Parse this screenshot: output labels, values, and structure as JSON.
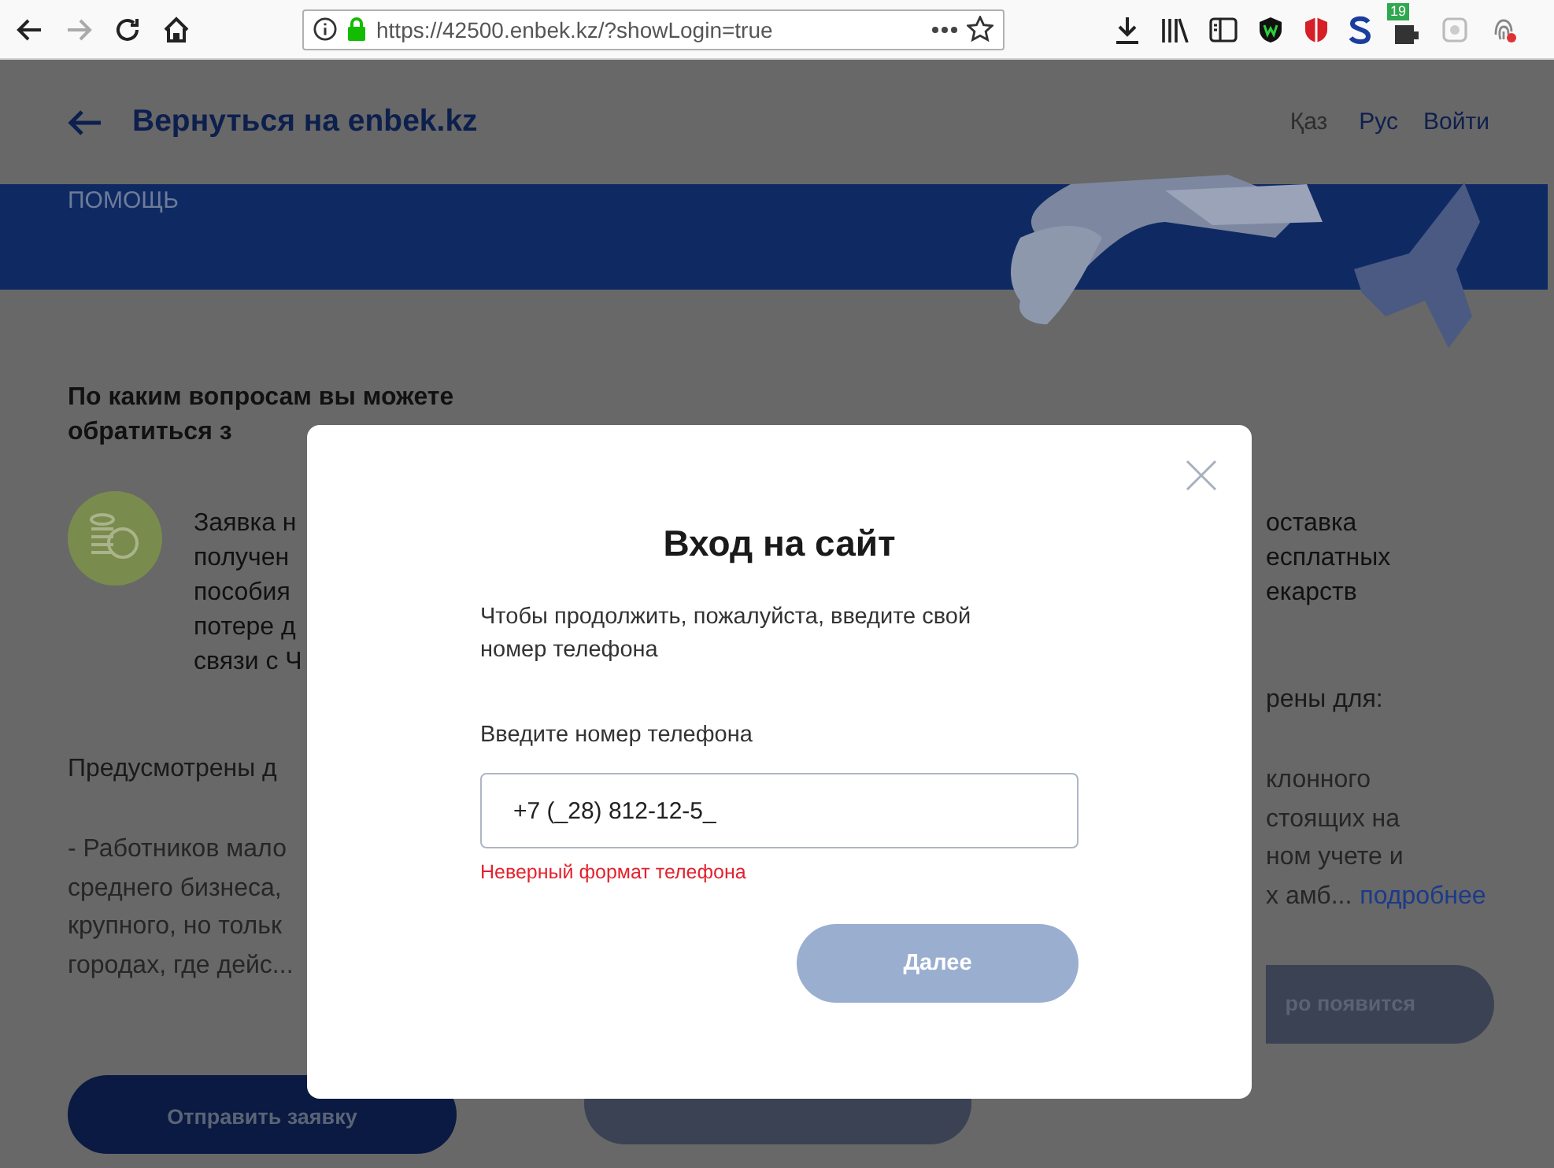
{
  "browser": {
    "url": "https://42500.enbek.kz/?showLogin=true",
    "badge": "19"
  },
  "header": {
    "back": "Вернуться на enbek.kz",
    "languages": [
      {
        "label": "Қаз",
        "selected": false
      },
      {
        "label": "Рус",
        "selected": true
      }
    ],
    "login": "Войти"
  },
  "banner": {
    "caption": "ПОМОЩЬ"
  },
  "section": {
    "heading_lines": [
      "По каким вопросам вы можете",
      "обратиться з"
    ],
    "left_card": {
      "title_lines": [
        "Заявка н",
        "получен",
        "пособия",
        "потере д",
        "связи с Ч"
      ],
      "subtitle": "Предусмотрены д",
      "body_lines": [
        "- Работников мало",
        "среднего бизнеса,",
        "крупного, но тольк",
        "городах, где дейс..."
      ],
      "button": "Отправить заявку"
    },
    "right_card": {
      "title_lines": [
        "оставка",
        "есплатных",
        "екарств"
      ],
      "subtitle": "рены для:",
      "body_lines": [
        "клонного",
        "стоящих на",
        "ном учете и",
        "х амб..."
      ],
      "more_link": "подробнее",
      "button": "ро появится"
    }
  },
  "modal": {
    "title": "Вход на сайт",
    "description": "Чтобы продолжить, пожалуйста, введите свой номер телефона",
    "field_label": "Введите номер телефона",
    "phone_value": "+7 (_28) 812-12-5_",
    "error": "Неверный формат телефона",
    "submit": {
      "label": "Далее",
      "disabled": true
    }
  }
}
